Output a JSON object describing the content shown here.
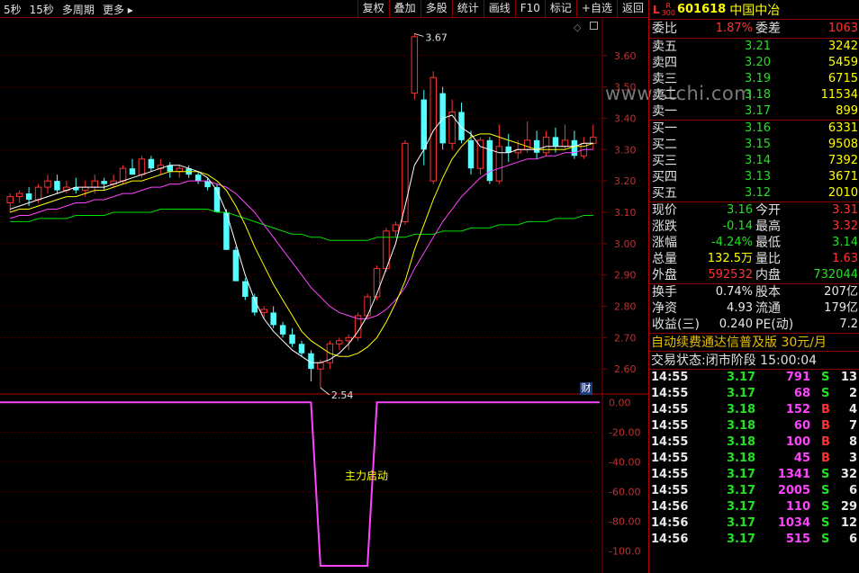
{
  "toolbar": {
    "left": [
      "5秒",
      "15秒",
      "多周期",
      "更多 ▸"
    ],
    "right": [
      "复权",
      "叠加",
      "多股",
      "统计",
      "画线",
      "F10",
      "标记",
      "+自选",
      "返回"
    ]
  },
  "chart": {
    "y_ticks": [
      "3.60",
      "3.50",
      "3.40",
      "3.30",
      "3.20",
      "3.10",
      "3.00",
      "2.90",
      "2.80",
      "2.70",
      "2.60"
    ],
    "max_label": "3.67",
    "min_label": "2.54",
    "indicator_ticks": [
      "0.00",
      "-20.00",
      "-40.00",
      "-60.00",
      "-80.00",
      "-100.0"
    ],
    "indicator_label": "主力启动",
    "cai_label": "财"
  },
  "chart_data": {
    "type": "candlestick",
    "ylim": [
      2.52,
      3.72
    ],
    "candles": [
      [
        3.13,
        3.16,
        3.1,
        3.15
      ],
      [
        3.15,
        3.17,
        3.13,
        3.16
      ],
      [
        3.16,
        3.18,
        3.12,
        3.14
      ],
      [
        3.14,
        3.19,
        3.13,
        3.18
      ],
      [
        3.18,
        3.22,
        3.16,
        3.2
      ],
      [
        3.2,
        3.22,
        3.16,
        3.17
      ],
      [
        3.17,
        3.2,
        3.16,
        3.18
      ],
      [
        3.18,
        3.21,
        3.16,
        3.17
      ],
      [
        3.17,
        3.2,
        3.15,
        3.18
      ],
      [
        3.18,
        3.22,
        3.16,
        3.2
      ],
      [
        3.2,
        3.21,
        3.17,
        3.19
      ],
      [
        3.19,
        3.22,
        3.18,
        3.2
      ],
      [
        3.2,
        3.25,
        3.19,
        3.24
      ],
      [
        3.24,
        3.27,
        3.22,
        3.22
      ],
      [
        3.22,
        3.28,
        3.21,
        3.27
      ],
      [
        3.27,
        3.28,
        3.23,
        3.24
      ],
      [
        3.24,
        3.27,
        3.22,
        3.25
      ],
      [
        3.25,
        3.26,
        3.21,
        3.23
      ],
      [
        3.23,
        3.25,
        3.21,
        3.24
      ],
      [
        3.24,
        3.25,
        3.21,
        3.22
      ],
      [
        3.22,
        3.23,
        3.19,
        3.2
      ],
      [
        3.2,
        3.21,
        3.17,
        3.18
      ],
      [
        3.18,
        3.19,
        3.1,
        3.1
      ],
      [
        3.1,
        3.11,
        2.98,
        2.98
      ],
      [
        2.98,
        2.99,
        2.88,
        2.88
      ],
      [
        2.88,
        2.89,
        2.82,
        2.83
      ],
      [
        2.83,
        2.84,
        2.77,
        2.78
      ],
      [
        2.78,
        2.8,
        2.76,
        2.79
      ],
      [
        2.78,
        2.8,
        2.73,
        2.74
      ],
      [
        2.74,
        2.75,
        2.7,
        2.71
      ],
      [
        2.71,
        2.73,
        2.67,
        2.68
      ],
      [
        2.68,
        2.69,
        2.64,
        2.65
      ],
      [
        2.65,
        2.66,
        2.56,
        2.6
      ],
      [
        2.6,
        2.63,
        2.54,
        2.62
      ],
      [
        2.62,
        2.69,
        2.6,
        2.68
      ],
      [
        2.68,
        2.7,
        2.66,
        2.69
      ],
      [
        2.69,
        2.71,
        2.66,
        2.7
      ],
      [
        2.7,
        2.78,
        2.69,
        2.77
      ],
      [
        2.77,
        2.84,
        2.76,
        2.83
      ],
      [
        2.83,
        2.93,
        2.82,
        2.92
      ],
      [
        2.92,
        3.05,
        2.91,
        3.04
      ],
      [
        3.04,
        3.07,
        3.02,
        3.06
      ],
      [
        3.07,
        3.33,
        3.06,
        3.32
      ],
      [
        3.48,
        3.67,
        3.46,
        3.66
      ],
      [
        3.46,
        3.49,
        3.25,
        3.3
      ],
      [
        3.2,
        3.55,
        3.19,
        3.53
      ],
      [
        3.48,
        3.5,
        3.3,
        3.32
      ],
      [
        3.32,
        3.46,
        3.3,
        3.42
      ],
      [
        3.42,
        3.45,
        3.32,
        3.33
      ],
      [
        3.33,
        3.36,
        3.22,
        3.24
      ],
      [
        3.24,
        3.34,
        3.22,
        3.33
      ],
      [
        3.33,
        3.34,
        3.19,
        3.2
      ],
      [
        3.2,
        3.38,
        3.19,
        3.31
      ],
      [
        3.31,
        3.35,
        3.26,
        3.29
      ],
      [
        3.29,
        3.33,
        3.27,
        3.3
      ],
      [
        3.3,
        3.39,
        3.29,
        3.33
      ],
      [
        3.33,
        3.36,
        3.27,
        3.29
      ],
      [
        3.29,
        3.36,
        3.28,
        3.34
      ],
      [
        3.34,
        3.37,
        3.29,
        3.31
      ],
      [
        3.31,
        3.38,
        3.3,
        3.33
      ],
      [
        3.33,
        3.36,
        3.27,
        3.28
      ],
      [
        3.28,
        3.34,
        3.27,
        3.32
      ],
      [
        3.32,
        3.38,
        3.3,
        3.34
      ]
    ],
    "ma5": [
      3.11,
      3.12,
      3.13,
      3.14,
      3.15,
      3.16,
      3.17,
      3.18,
      3.18,
      3.18,
      3.18,
      3.19,
      3.2,
      3.21,
      3.22,
      3.23,
      3.24,
      3.25,
      3.25,
      3.24,
      3.23,
      3.21,
      3.17,
      3.1,
      3.0,
      2.9,
      2.82,
      2.76,
      2.72,
      2.69,
      2.66,
      2.64,
      2.62,
      2.62,
      2.63,
      2.65,
      2.68,
      2.72,
      2.77,
      2.84,
      2.92,
      3.0,
      3.12,
      3.25,
      3.3,
      3.36,
      3.4,
      3.41,
      3.37,
      3.35,
      3.31,
      3.3,
      3.29,
      3.29,
      3.3,
      3.3,
      3.3,
      3.31,
      3.31,
      3.31,
      3.31,
      3.32,
      3.32
    ],
    "ma10": [
      3.1,
      3.11,
      3.11,
      3.12,
      3.13,
      3.14,
      3.15,
      3.15,
      3.16,
      3.17,
      3.17,
      3.18,
      3.19,
      3.2,
      3.2,
      3.21,
      3.22,
      3.23,
      3.23,
      3.23,
      3.23,
      3.22,
      3.2,
      3.17,
      3.12,
      3.06,
      2.99,
      2.93,
      2.87,
      2.82,
      2.77,
      2.72,
      2.69,
      2.67,
      2.65,
      2.64,
      2.64,
      2.65,
      2.67,
      2.7,
      2.75,
      2.81,
      2.88,
      2.98,
      3.06,
      3.14,
      3.21,
      3.27,
      3.31,
      3.34,
      3.35,
      3.35,
      3.34,
      3.33,
      3.32,
      3.31,
      3.3,
      3.3,
      3.3,
      3.3,
      3.31,
      3.31,
      3.32
    ],
    "ma20": [
      3.08,
      3.09,
      3.09,
      3.1,
      3.11,
      3.11,
      3.12,
      3.13,
      3.13,
      3.14,
      3.14,
      3.15,
      3.16,
      3.16,
      3.17,
      3.18,
      3.18,
      3.19,
      3.19,
      3.2,
      3.2,
      3.2,
      3.19,
      3.18,
      3.16,
      3.13,
      3.1,
      3.06,
      3.02,
      2.98,
      2.94,
      2.9,
      2.86,
      2.83,
      2.8,
      2.78,
      2.77,
      2.76,
      2.76,
      2.77,
      2.79,
      2.82,
      2.86,
      2.92,
      2.97,
      3.02,
      3.07,
      3.11,
      3.15,
      3.18,
      3.21,
      3.23,
      3.24,
      3.25,
      3.26,
      3.27,
      3.27,
      3.28,
      3.28,
      3.29,
      3.29,
      3.3,
      3.3
    ],
    "ma60": [
      3.07,
      3.07,
      3.07,
      3.08,
      3.08,
      3.08,
      3.08,
      3.09,
      3.09,
      3.09,
      3.09,
      3.1,
      3.1,
      3.1,
      3.1,
      3.1,
      3.11,
      3.11,
      3.11,
      3.11,
      3.11,
      3.11,
      3.1,
      3.1,
      3.09,
      3.08,
      3.07,
      3.06,
      3.05,
      3.04,
      3.03,
      3.03,
      3.02,
      3.02,
      3.01,
      3.01,
      3.01,
      3.01,
      3.01,
      3.02,
      3.02,
      3.02,
      3.02,
      3.03,
      3.03,
      3.03,
      3.04,
      3.04,
      3.04,
      3.05,
      3.05,
      3.05,
      3.06,
      3.06,
      3.06,
      3.07,
      3.07,
      3.07,
      3.08,
      3.08,
      3.08,
      3.09,
      3.09
    ],
    "indicator": {
      "ylim": [
        -110,
        5
      ],
      "values": [
        0,
        0,
        0,
        0,
        0,
        0,
        0,
        0,
        0,
        0,
        0,
        0,
        0,
        0,
        0,
        0,
        0,
        0,
        0,
        0,
        0,
        0,
        0,
        0,
        0,
        0,
        0,
        0,
        0,
        0,
        0,
        0,
        0,
        -110,
        -110,
        -110,
        -110,
        -110,
        -110,
        0,
        0,
        0,
        0,
        0,
        0,
        0,
        0,
        0,
        0,
        0,
        0,
        0,
        0,
        0,
        0,
        0,
        0,
        0,
        0,
        0,
        0,
        0,
        0
      ]
    }
  },
  "quote": {
    "l_mark": "L",
    "r_mark": "R",
    "r_sub": "300",
    "code": "601618",
    "name": "中国中冶",
    "weibi_label": "委比",
    "weibi": "1.87%",
    "weicha_label": "委差",
    "weicha": "1063",
    "asks": [
      {
        "label": "卖五",
        "price": "3.21",
        "vol": "3242"
      },
      {
        "label": "卖四",
        "price": "3.20",
        "vol": "5459"
      },
      {
        "label": "卖三",
        "price": "3.19",
        "vol": "6715"
      },
      {
        "label": "卖二",
        "price": "3.18",
        "vol": "11534"
      },
      {
        "label": "卖一",
        "price": "3.17",
        "vol": "899"
      }
    ],
    "bids": [
      {
        "label": "买一",
        "price": "3.16",
        "vol": "6331"
      },
      {
        "label": "买二",
        "price": "3.15",
        "vol": "9508"
      },
      {
        "label": "买三",
        "price": "3.14",
        "vol": "7392"
      },
      {
        "label": "买四",
        "price": "3.13",
        "vol": "3671"
      },
      {
        "label": "买五",
        "price": "3.12",
        "vol": "2010"
      }
    ],
    "stats1": [
      {
        "l1": "现价",
        "v1": "3.16",
        "c1": "grn",
        "l2": "今开",
        "v2": "3.31",
        "c2": "red"
      },
      {
        "l1": "涨跌",
        "v1": "-0.14",
        "c1": "grn",
        "l2": "最高",
        "v2": "3.32",
        "c2": "red"
      },
      {
        "l1": "涨幅",
        "v1": "-4.24%",
        "c1": "grn",
        "l2": "最低",
        "v2": "3.14",
        "c2": "grn"
      },
      {
        "l1": "总量",
        "v1": "132.5万",
        "c1": "yel",
        "l2": "量比",
        "v2": "1.63",
        "c2": "red"
      },
      {
        "l1": "外盘",
        "v1": "592532",
        "c1": "red",
        "l2": "内盘",
        "v2": "732044",
        "c2": "grn"
      }
    ],
    "stats2": [
      {
        "l1": "换手",
        "v1": "0.74%",
        "c1": "wht",
        "l2": "股本",
        "v2": "207亿",
        "c2": "wht"
      },
      {
        "l1": "净资",
        "v1": "4.93",
        "c1": "wht",
        "l2": "流通",
        "v2": "179亿",
        "c2": "wht"
      },
      {
        "l1": "收益(三)",
        "v1": "0.240",
        "c1": "wht",
        "l2": "PE(动)",
        "v2": "7.2",
        "c2": "wht"
      }
    ],
    "promo": "自动续费通达信普及版",
    "promo_price": "30元/月",
    "state_label": "交易状态:",
    "state_value": "闭市阶段 15:00:04",
    "ticks": [
      {
        "t": "14:55",
        "p": "3.17",
        "v": "791",
        "s": "S",
        "n": "13"
      },
      {
        "t": "14:55",
        "p": "3.17",
        "v": "68",
        "s": "S",
        "n": "2"
      },
      {
        "t": "14:55",
        "p": "3.18",
        "v": "152",
        "s": "B",
        "n": "4"
      },
      {
        "t": "14:55",
        "p": "3.18",
        "v": "60",
        "s": "B",
        "n": "7"
      },
      {
        "t": "14:55",
        "p": "3.18",
        "v": "100",
        "s": "B",
        "n": "8"
      },
      {
        "t": "14:55",
        "p": "3.18",
        "v": "45",
        "s": "B",
        "n": "3"
      },
      {
        "t": "14:55",
        "p": "3.17",
        "v": "1341",
        "s": "S",
        "n": "32"
      },
      {
        "t": "14:55",
        "p": "3.17",
        "v": "2005",
        "s": "S",
        "n": "6"
      },
      {
        "t": "14:56",
        "p": "3.17",
        "v": "110",
        "s": "S",
        "n": "29"
      },
      {
        "t": "14:56",
        "p": "3.17",
        "v": "1034",
        "s": "S",
        "n": "12"
      },
      {
        "t": "14:56",
        "p": "3.17",
        "v": "515",
        "s": "S",
        "n": "6"
      }
    ]
  },
  "watermark": "www.stchi.com",
  "colors": {
    "up": "#ff3232",
    "down": "#54ffff",
    "ma5": "#ffffff",
    "ma10": "#ffff00",
    "ma20": "#ff44ff",
    "ma60": "#00e000",
    "indicator": "#ff44ff",
    "grid": "#8b0000"
  }
}
